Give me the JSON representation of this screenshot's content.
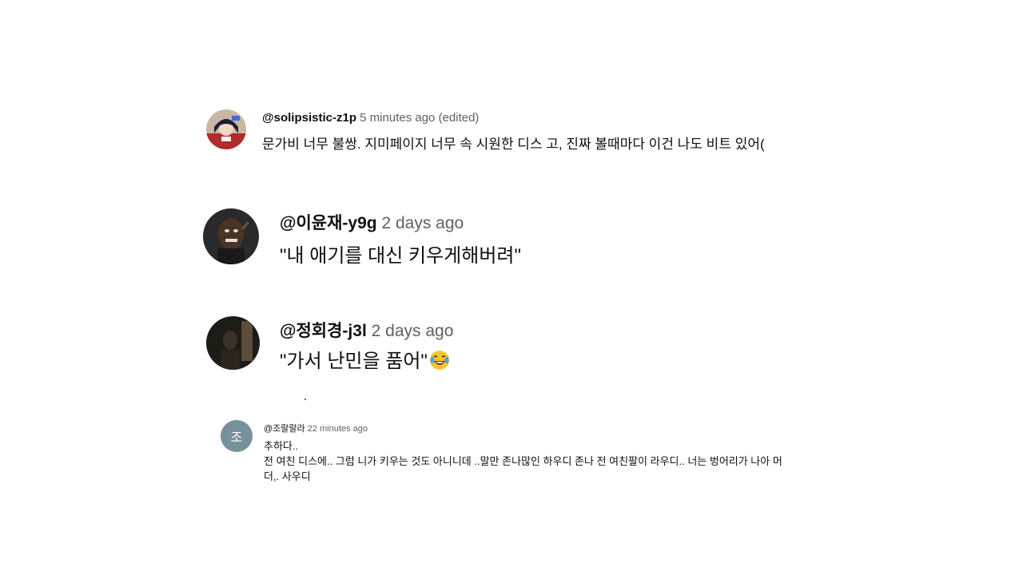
{
  "comments": [
    {
      "handle": "@solipsistic-z1p",
      "time": "5 minutes ago (edited)",
      "text": "문가비 너무 불쌍. 지미페이지 너무 속 시원한 디스 고, 진짜 볼때마다 이건 나도 비트 있어("
    },
    {
      "handle": "@이윤재-y9g",
      "time": "2 days ago",
      "text": "\"내 애기를 대신 키우게해버려\""
    },
    {
      "handle": "@정회경-j3l",
      "time": "2 days ago",
      "text": "\"가서 난민을 품어\"",
      "emoji": "face-with-tears-of-joy"
    },
    {
      "avatar_letter": "조",
      "handle": "@조랄랄라",
      "time": "22 minutes ago",
      "lines": [
        "추하다..",
        "전 여친 디스에.. 그럼 니가 키우는  것도 아니니데 ..말만 존나많인 하우디 존나 전 여친팔이 라우디.. 너는 벙어리가 나아 머",
        "더,. 사우디"
      ]
    }
  ],
  "colors": {
    "handle": "#0f0f0f",
    "timestamp": "#606060",
    "letter_avatar_bg": "#77909c"
  }
}
